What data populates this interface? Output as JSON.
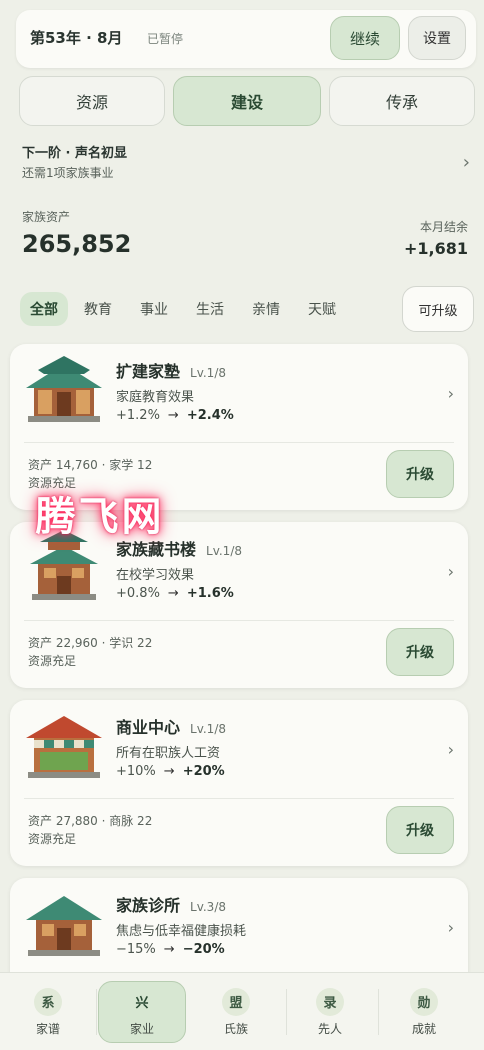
{
  "header": {
    "date": "第53年 · 8月",
    "status": "已暂停",
    "continue_label": "继续",
    "settings_label": "设置"
  },
  "tabs": [
    {
      "label": "资源"
    },
    {
      "label": "建设"
    },
    {
      "label": "传承"
    }
  ],
  "next_stage": {
    "title": "下一阶 · 声名初显",
    "subtitle": "还需1项家族事业"
  },
  "assets": {
    "label": "家族资产",
    "value": "265,852",
    "monthly_label": "本月结余",
    "monthly_value": "+1,681"
  },
  "filters": {
    "chips": [
      "全部",
      "教育",
      "事业",
      "生活",
      "亲情",
      "天赋"
    ],
    "active": "全部",
    "upgradable_label": "可升级"
  },
  "cards": [
    {
      "name": "扩建家塾",
      "level": "Lv.1/8",
      "effect": "家庭教育效果",
      "before": "+1.2%",
      "after": "+2.4%",
      "req": "资产 14,760 · 家学 12",
      "status": "资源充足",
      "button": "升级"
    },
    {
      "name": "家族藏书楼",
      "level": "Lv.1/8",
      "effect": "在校学习效果",
      "before": "+0.8%",
      "after": "+1.6%",
      "req": "资产 22,960 · 学识 22",
      "status": "资源充足",
      "button": "升级"
    },
    {
      "name": "商业中心",
      "level": "Lv.1/8",
      "effect": "所有在职族人工资",
      "before": "+10%",
      "after": "+20%",
      "req": "资产 27,880 · 商脉 22",
      "status": "资源充足",
      "button": "升级"
    },
    {
      "name": "家族诊所",
      "level": "Lv.3/8",
      "effect": "焦虑与低幸福健康损耗",
      "before": "−15%",
      "after": "−20%"
    }
  ],
  "watermark": "腾飞网",
  "bottom_nav": [
    {
      "glyph": "系",
      "label": "家谱"
    },
    {
      "glyph": "兴",
      "label": "家业"
    },
    {
      "glyph": "盟",
      "label": "氏族"
    },
    {
      "glyph": "录",
      "label": "先人"
    },
    {
      "glyph": "勋",
      "label": "成就"
    }
  ],
  "colors": {
    "accent_green": "#d7e7d2",
    "background": "#eef0e8",
    "card": "#fbfbf7"
  }
}
